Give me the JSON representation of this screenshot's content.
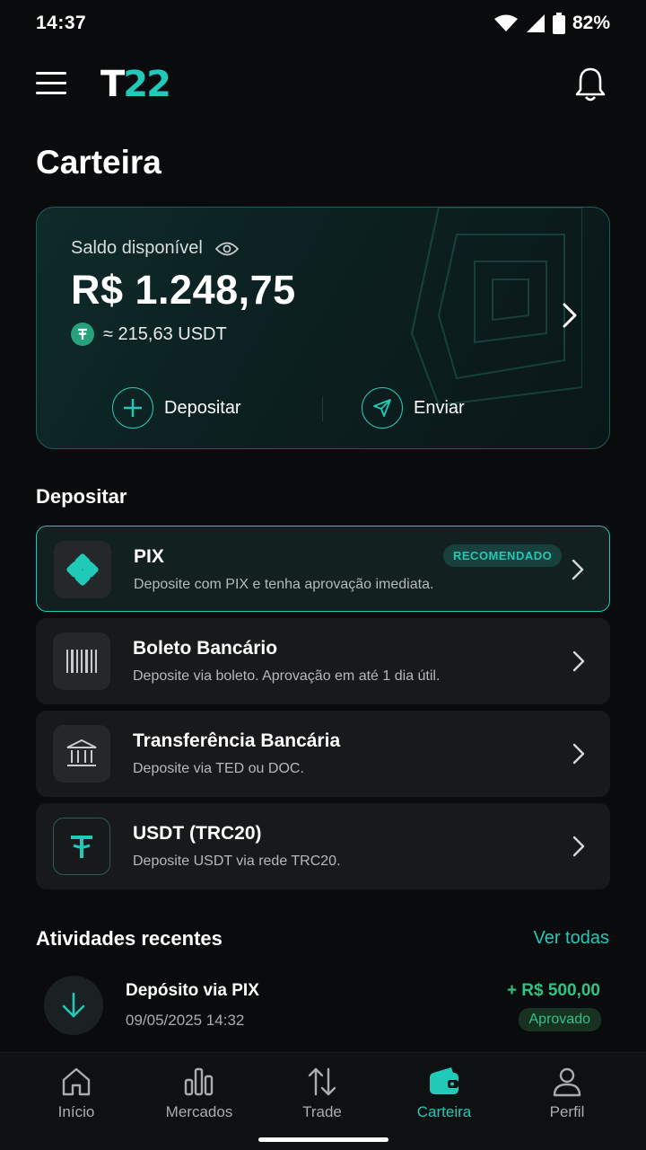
{
  "status_bar": {
    "time": "14:37",
    "battery": "82%"
  },
  "header": {
    "logo_left": "T",
    "logo_right": "22"
  },
  "page": {
    "title": "Carteira"
  },
  "balance_card": {
    "label": "Saldo disponível",
    "value": "R$ 1.248,75",
    "usdt": "≈ 215,63 USDT",
    "deposit_label": "Depositar",
    "send_label": "Enviar"
  },
  "deposit_section": {
    "title": "Depositar",
    "options": [
      {
        "name": "PIX",
        "description": "Deposite com PIX e tenha aprovação imediata.",
        "badge": "RECOMENDADO",
        "icon": "pix-icon"
      },
      {
        "name": "Boleto Bancário",
        "description": "Deposite via boleto. Aprovação em até 1 dia útil.",
        "icon": "barcode-icon"
      },
      {
        "name": "Transferência Bancária",
        "description": "Deposite via TED ou DOC.",
        "icon": "bank-icon"
      },
      {
        "name": "USDT (TRC20)",
        "description": "Deposite USDT via rede TRC20.",
        "icon": "tether-icon"
      }
    ]
  },
  "activities": {
    "title": "Atividades recentes",
    "see_all": "Ver todas",
    "items": [
      {
        "name": "Depósito via PIX",
        "date": "09/05/2025 14:32",
        "amount": "+ R$ 500,00",
        "status": "Aprovado"
      }
    ]
  },
  "bottom_nav": {
    "items": [
      {
        "label": "Início",
        "icon": "home-icon"
      },
      {
        "label": "Mercados",
        "icon": "bar-chart-icon"
      },
      {
        "label": "Trade",
        "icon": "swap-icon"
      },
      {
        "label": "Carteira",
        "icon": "wallet-icon"
      },
      {
        "label": "Perfil",
        "icon": "user-icon"
      }
    ],
    "active": "Carteira"
  },
  "colors": {
    "accent": "#21c9b8",
    "positive": "#2fc483",
    "background": "#0a0b0c"
  }
}
